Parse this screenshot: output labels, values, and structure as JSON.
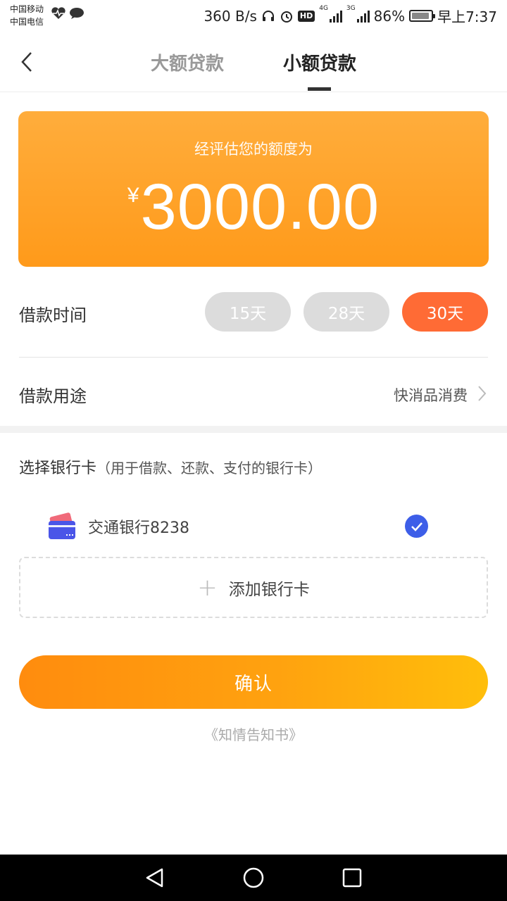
{
  "status_bar": {
    "carrier_1": "中国移动",
    "carrier_2": "中国电信",
    "net_speed": "360 B/s",
    "net_tag_1": "4G",
    "net_tag_2": "3G",
    "hd": "HD",
    "battery": "86%",
    "time": "早上7:37"
  },
  "header": {
    "tabs": [
      {
        "label": "大额贷款",
        "active": false
      },
      {
        "label": "小额贷款",
        "active": true
      }
    ]
  },
  "quota": {
    "label": "经评估您的额度为",
    "currency": "¥",
    "amount": "3000.00"
  },
  "loan_period": {
    "label": "借款时间",
    "options": [
      "15天",
      "28天",
      "30天"
    ],
    "selected": "30天"
  },
  "loan_purpose": {
    "label": "借款用途",
    "value": "快消品消费"
  },
  "bank_card": {
    "title": "选择银行卡",
    "subtitle": "（用于借款、还款、支付的银行卡）",
    "cards": [
      {
        "name": "交通银行8238",
        "selected": true
      }
    ],
    "add_label": "添加银行卡"
  },
  "confirm_label": "确认",
  "notice_link": "《知情告知书》",
  "colors": {
    "accent_orange": "#ff9a1a",
    "selected_pill": "#ff6b35",
    "check_blue": "#3d5ee8"
  }
}
